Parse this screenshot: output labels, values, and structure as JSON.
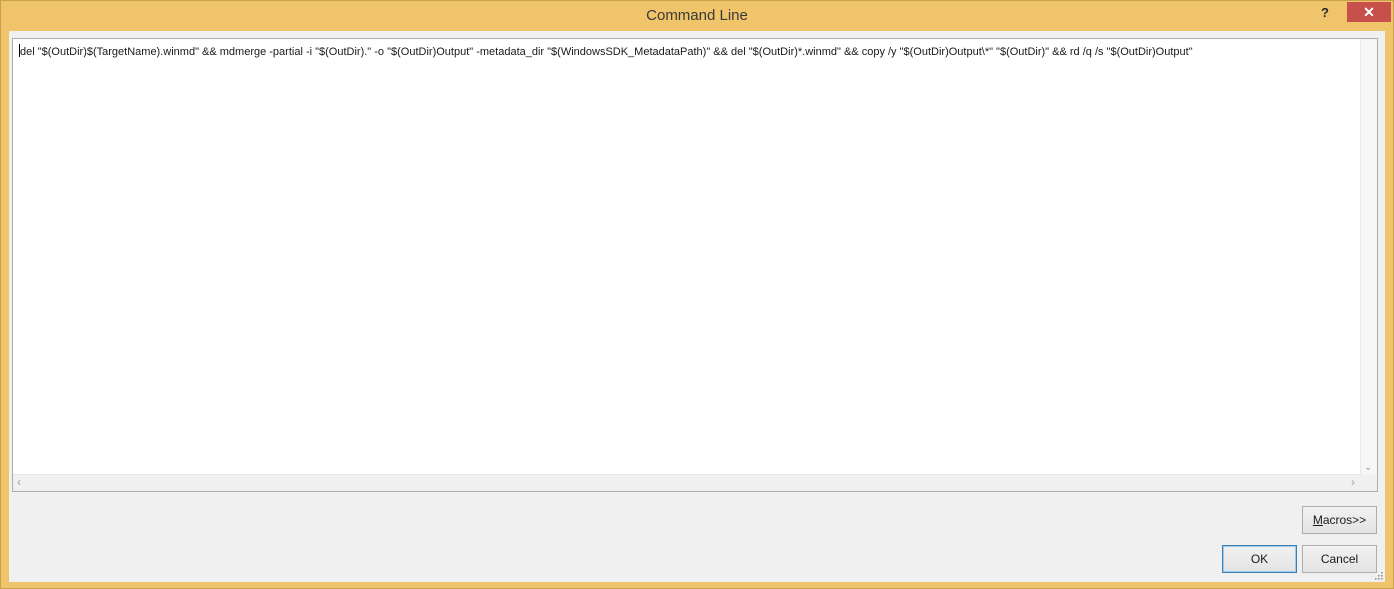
{
  "window": {
    "title": "Command Line",
    "help_glyph": "?",
    "close_glyph": "✕"
  },
  "editor": {
    "command_text": "del \"$(OutDir)$(TargetName).winmd\" && mdmerge -partial -i \"$(OutDir).\" -o \"$(OutDir)Output\" -metadata_dir \"$(WindowsSDK_MetadataPath)\" && del \"$(OutDir)*.winmd\" && copy /y \"$(OutDir)Output\\*\" \"$(OutDir)\" && rd /q /s \"$(OutDir)Output\"",
    "scroll_up_glyph": "",
    "scroll_down_glyph": "⌄",
    "scroll_left_glyph": "‹",
    "scroll_right_glyph": "›"
  },
  "buttons": {
    "macros_label": "Macros>>",
    "ok_label": "OK",
    "cancel_label": "Cancel"
  },
  "colors": {
    "title_bar": "#f0c46a",
    "close_button": "#c7504a",
    "dialog_background": "#f0f0f0",
    "default_button_border": "#3c7fb1"
  },
  "icons": {
    "help": "help-icon",
    "close": "close-icon",
    "resize_grip": "resize-grip-icon"
  }
}
